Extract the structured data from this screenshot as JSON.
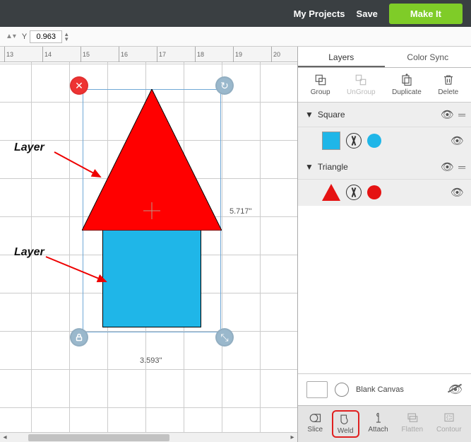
{
  "topbar": {
    "my_projects": "My Projects",
    "save": "Save",
    "make_it": "Make It"
  },
  "toolbar": {
    "y_label": "Y",
    "y_value": "0.963"
  },
  "ruler": {
    "ticks": [
      "13",
      "14",
      "15",
      "16",
      "17",
      "18",
      "19",
      "20"
    ]
  },
  "canvas": {
    "width_label": "3.593\"",
    "height_label": "5.717\"",
    "anno_top": "Layer",
    "anno_bottom": "Layer"
  },
  "panel": {
    "tabs": {
      "layers": "Layers",
      "color_sync": "Color Sync"
    },
    "actions": {
      "group": "Group",
      "ungroup": "UnGroup",
      "duplicate": "Duplicate",
      "delete": "Delete"
    }
  },
  "layers": [
    {
      "name": "Square",
      "color": "#1fb6e8",
      "shape": "square"
    },
    {
      "name": "Triangle",
      "color": "#e51313",
      "shape": "triangle"
    }
  ],
  "blank_canvas": {
    "label": "Blank Canvas"
  },
  "bottom_tools": {
    "slice": "Slice",
    "weld": "Weld",
    "attach": "Attach",
    "flatten": "Flatten",
    "contour": "Contour"
  },
  "colors": {
    "accent_green": "#7fcc28",
    "red": "#ff0000",
    "cyan": "#1fb6e8"
  }
}
